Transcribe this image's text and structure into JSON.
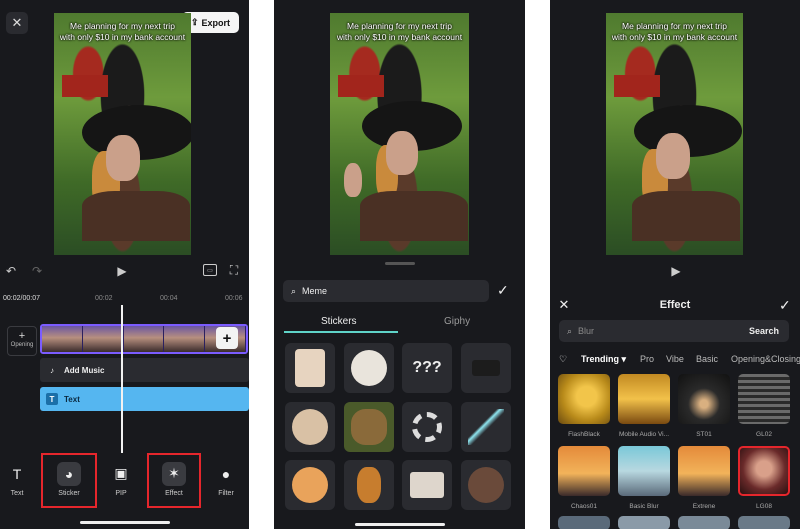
{
  "video": {
    "caption_line1": "Me planning for my next trip",
    "caption_line2": "with only $10 in my bank account"
  },
  "editor": {
    "close_glyph": "✕",
    "export_label": "Export",
    "undo_glyph": "↶",
    "redo_glyph": "↷",
    "play_glyph": "▶",
    "ruler": [
      "00:02/00:07",
      "00:02",
      "00:04",
      "00:06"
    ],
    "opening_plus": "+",
    "opening_label": "Opening",
    "add_clip_glyph": "+",
    "music_label": "Add Music",
    "text_label": "Text",
    "tools": [
      {
        "label": "Text",
        "icon": "T"
      },
      {
        "label": "Sticker",
        "icon": "◕"
      },
      {
        "label": "PIP",
        "icon": "▣"
      },
      {
        "label": "Effect",
        "icon": "✶"
      },
      {
        "label": "Filter",
        "icon": "●"
      }
    ]
  },
  "sticker_panel": {
    "search_value": "Meme",
    "tabs": [
      "Stickers",
      "Giphy"
    ],
    "check_glyph": "✓",
    "qmarks": "???"
  },
  "effect_panel": {
    "close_glyph": "✕",
    "title": "Effect",
    "check_glyph": "✓",
    "search_placeholder": "Blur",
    "search_button": "Search",
    "categories": [
      "Trending ▾",
      "Pro",
      "Vibe",
      "Basic",
      "Opening&Closing"
    ],
    "items": [
      "FlashBlack",
      "Mobile Audio Vi...",
      "ST01",
      "GL02",
      "Chaos01",
      "Basic Blur",
      "Extrene",
      "LG08"
    ]
  },
  "colors": {
    "background": "#18191d",
    "accent_teal": "#5fd3c8",
    "text_track": "#55b6f0",
    "clip_border": "#7b5cff",
    "highlight_red": "#e5262c"
  }
}
